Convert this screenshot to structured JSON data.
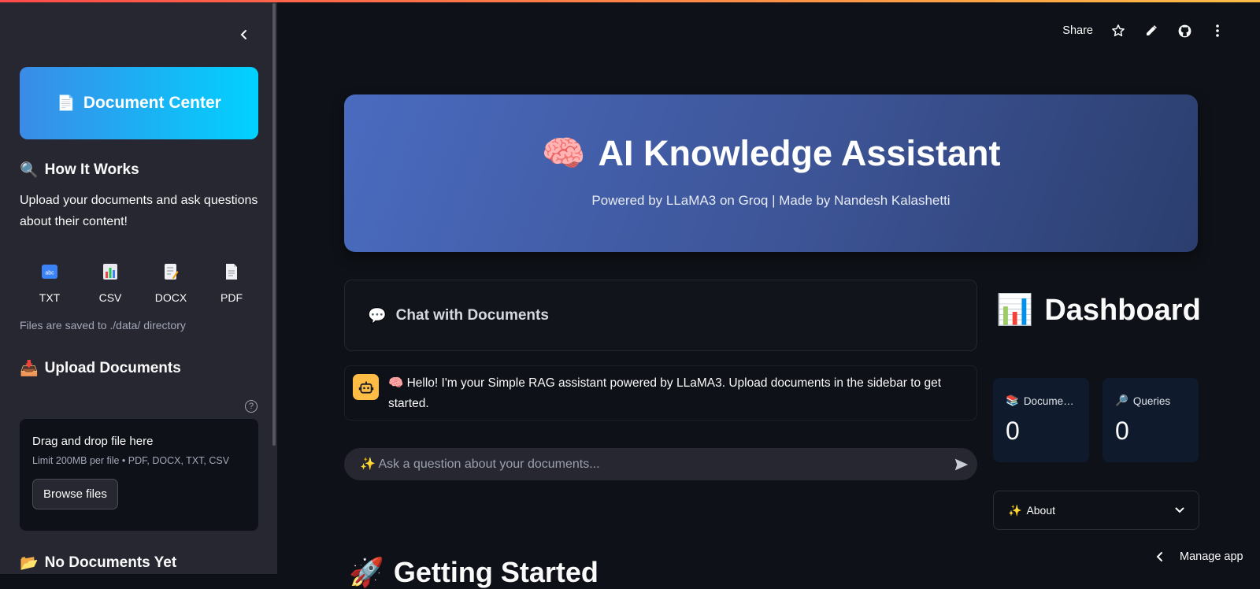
{
  "sidebar": {
    "document_center": {
      "emoji": "📄",
      "label": "Document Center"
    },
    "how_it_works": {
      "emoji": "🔍",
      "title": "How It Works"
    },
    "description": "Upload your documents and ask questions about their content!",
    "formats": [
      {
        "label": "TXT",
        "icon": "abc-icon"
      },
      {
        "label": "CSV",
        "icon": "bar-chart-icon"
      },
      {
        "label": "DOCX",
        "icon": "memo-icon"
      },
      {
        "label": "PDF",
        "icon": "document-icon"
      }
    ],
    "save_note": "Files are saved to ./data/ directory",
    "upload": {
      "emoji": "📥",
      "title": "Upload Documents"
    },
    "dropzone": {
      "title": "Drag and drop file here",
      "limit": "Limit 200MB per file • PDF, DOCX, TXT, CSV",
      "browse_label": "Browse files"
    },
    "no_docs": {
      "emoji": "📂",
      "title": "No Documents Yet"
    }
  },
  "toolbar": {
    "share_label": "Share"
  },
  "hero": {
    "emoji": "🧠",
    "title": "AI Knowledge Assistant",
    "subtitle": "Powered by LLaMA3 on Groq | Made by Nandesh Kalashetti"
  },
  "chat": {
    "header_emoji": "💬",
    "header": "Chat with Documents",
    "message": "🧠 Hello! I'm your Simple RAG assistant powered by LLaMA3. Upload documents in the sidebar to get started.",
    "input_placeholder": "✨ Ask a question about your documents..."
  },
  "dashboard": {
    "emoji": "📊",
    "title": "Dashboard",
    "metrics": [
      {
        "emoji": "📚",
        "label": "Docume…",
        "value": "0"
      },
      {
        "emoji": "🔎",
        "label": "Queries",
        "value": "0"
      }
    ],
    "about": {
      "emoji": "✨",
      "label": "About"
    }
  },
  "getting_started": {
    "emoji": "🚀",
    "title": "Getting Started"
  },
  "manage_app": "Manage app",
  "colors": {
    "accent": "#ff4b4b",
    "avatar": "#ffbd45",
    "sidebar_bg": "#262730",
    "main_bg": "#0e1117"
  }
}
